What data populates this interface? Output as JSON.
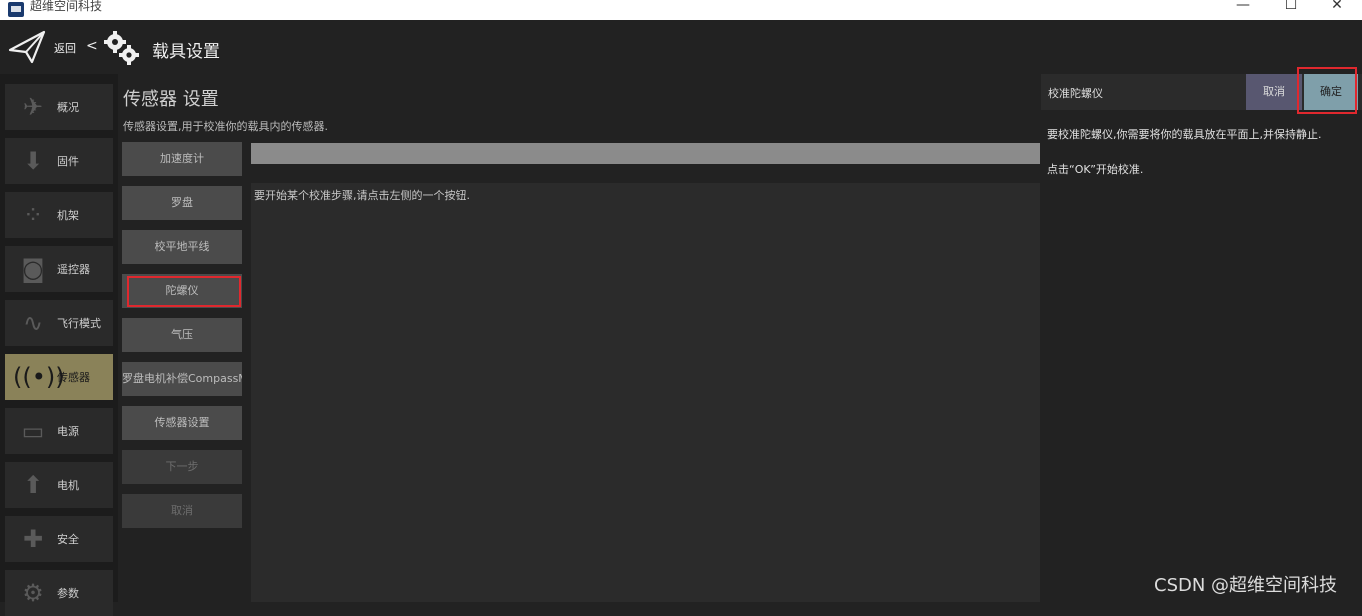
{
  "window": {
    "title": "超维空间科技",
    "controls": {
      "minimize": "—",
      "maximize": "☐",
      "close": "✕"
    }
  },
  "header": {
    "back_label": "返回",
    "chevron": "<",
    "title": "载具设置"
  },
  "nav": {
    "items": [
      {
        "label": "概况",
        "icon": "plane-icon"
      },
      {
        "label": "固件",
        "icon": "download-icon"
      },
      {
        "label": "机架",
        "icon": "frame-icon"
      },
      {
        "label": "遥控器",
        "icon": "remote-icon"
      },
      {
        "label": "飞行模式",
        "icon": "wave-icon"
      },
      {
        "label": "传感器",
        "icon": "sensor-icon",
        "active": true
      },
      {
        "label": "电源",
        "icon": "battery-icon"
      },
      {
        "label": "电机",
        "icon": "motor-icon"
      },
      {
        "label": "安全",
        "icon": "safety-icon"
      },
      {
        "label": "参数",
        "icon": "params-icon"
      }
    ],
    "active_color": "#8a8259"
  },
  "section": {
    "title": "传感器 设置",
    "description": "传感器设置,用于校准你的载具内的传感器."
  },
  "sensor_buttons": [
    {
      "label": "加速度计"
    },
    {
      "label": "罗盘"
    },
    {
      "label": "校平地平线"
    },
    {
      "label": "陀螺仪",
      "highlighted": true
    },
    {
      "label": "气压"
    },
    {
      "label": "罗盘电机补偿CompassMot"
    },
    {
      "label": "传感器设置"
    },
    {
      "label": "下一步",
      "disabled": true
    },
    {
      "label": "取消",
      "disabled": true
    }
  ],
  "main": {
    "instruction": "要开始某个校准步骤,请点击左侧的一个按钮."
  },
  "right_panel": {
    "title": "校准陀螺仪",
    "cancel_label": "取消",
    "ok_label": "确定",
    "line1": "要校准陀螺仪,你需要将你的载具放在平面上,并保持静止.",
    "line2": "点击“OK”开始校准."
  },
  "watermark": "CSDN @超维空间科技",
  "colors": {
    "highlight_border": "#e0282e",
    "ok_button": "#7f9faa",
    "cancel_button": "#585770"
  }
}
